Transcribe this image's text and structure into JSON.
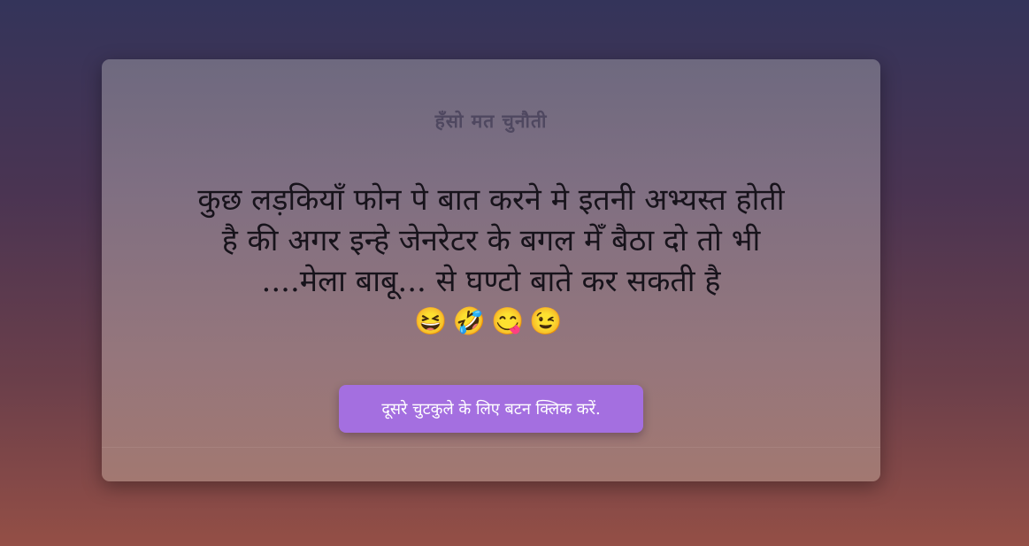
{
  "card": {
    "title": "हँसो मत चुनौती",
    "joke_text": "कुछ लड़कियाँ फोन पे बात करने मे इतनी अभ्यस्त होती है की अगर इन्हे जेनरेटर के बगल मेँ बैठा दो तो भी ....मेला बाबू... से घण्टो बाते कर सकती है",
    "joke_emojis": "😆🤣😋😉",
    "next_button_label": "दूसरे चुटकुले के लिए बटन क्लिक करें."
  }
}
